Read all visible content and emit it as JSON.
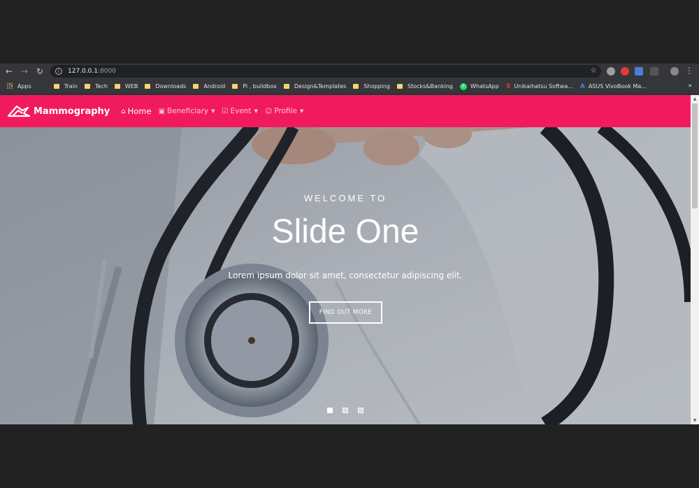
{
  "browser": {
    "url_host": "127.0.0.1",
    "url_port": ":8000",
    "nav": {
      "back_icon": "back-arrow-icon",
      "forward_icon": "forward-arrow-icon",
      "reload_icon": "reload-icon"
    },
    "more_bookmarks": "»",
    "bookmarks": [
      {
        "label": "Apps",
        "icon": "apps-grid-icon"
      },
      {
        "label": "Train",
        "icon": "folder-icon"
      },
      {
        "label": "Tech",
        "icon": "folder-icon"
      },
      {
        "label": "WEB",
        "icon": "folder-icon"
      },
      {
        "label": "Downloads",
        "icon": "folder-icon"
      },
      {
        "label": "Android",
        "icon": "folder-icon"
      },
      {
        "label": "Pi , buildbox",
        "icon": "folder-icon"
      },
      {
        "label": "Design&Templates",
        "icon": "folder-icon"
      },
      {
        "label": "Shopping",
        "icon": "folder-icon"
      },
      {
        "label": "Stocks&Banking",
        "icon": "folder-icon"
      },
      {
        "label": "WhatsApp",
        "icon": "whatsapp-icon"
      },
      {
        "label": "Unikaihatsu Softwa...",
        "icon": "unikaihatsu-icon"
      },
      {
        "label": "ASUS VivoBook Ma...",
        "icon": "asus-icon"
      }
    ]
  },
  "site": {
    "brand": "Mammography",
    "nav": {
      "home": "Home",
      "beneficiary": "Beneficiary",
      "event": "Event",
      "profile": "Profile"
    },
    "accent_color": "#f21a5f"
  },
  "hero": {
    "eyebrow": "WELCOME TO",
    "title": "Slide One",
    "subtitle": "Lorem ipsum dolor sit amet, consectetur adipiscing elit.",
    "cta": "FIND OUT MORE",
    "slide_count": 3,
    "active_slide": 1
  }
}
